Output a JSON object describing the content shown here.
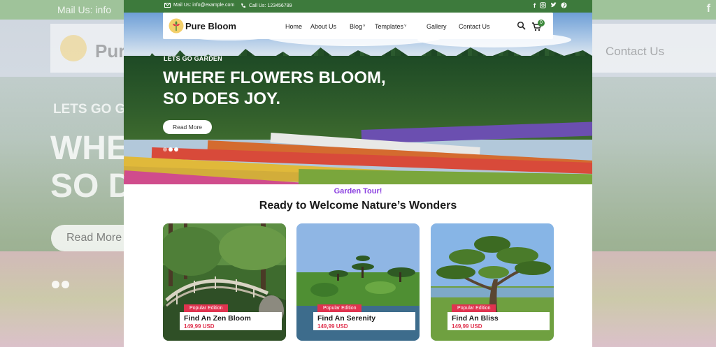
{
  "background": {
    "topbar_text": "Mail Us: info",
    "social": "f",
    "brand": "Pur",
    "contact": "Contact Us",
    "hero_sub": "LETS GO G",
    "hero_title_line1": "WHE",
    "hero_title_line2": "SO D",
    "read_more": "Read More"
  },
  "topbar": {
    "mail": "Mail Us: info@example.com",
    "call": "Call Us: 123456789",
    "socials": [
      "facebook-icon",
      "instagram-icon",
      "twitter-icon",
      "pinterest-icon"
    ]
  },
  "header": {
    "brand": "Pure Bloom",
    "nav": [
      {
        "label": "Home",
        "has_dropdown": false
      },
      {
        "label": "About Us",
        "has_dropdown": false
      },
      {
        "label": "Blog",
        "has_dropdown": true
      },
      {
        "label": "Templates",
        "has_dropdown": true
      },
      {
        "label": "Gallery",
        "has_dropdown": false
      },
      {
        "label": "Contact Us",
        "has_dropdown": false
      }
    ],
    "cart_count": "0"
  },
  "hero": {
    "subtitle": "LETS GO GARDEN",
    "title_line1": "WHERE FLOWERS BLOOM,",
    "title_line2": "SO DOES JOY.",
    "button": "Read More",
    "slides": 3,
    "active_slide": 2
  },
  "section": {
    "kicker": "Garden  Tour!",
    "title": "Ready to Welcome Nature’s Wonders"
  },
  "cards": [
    {
      "badge": "Popular Edition",
      "name": "Find An Zen Bloom",
      "price": "149,99 USD"
    },
    {
      "badge": "Popular Edition",
      "name": "Find An Serenity",
      "price": "149,99 USD"
    },
    {
      "badge": "Popular Edition",
      "name": "Find An Bliss",
      "price": "149,99 USD"
    }
  ],
  "colors": {
    "topbar": "#3d7a3c",
    "badge": "#e0334f",
    "kicker": "#8a3fe0",
    "cart_badge": "#3d8a3c"
  }
}
